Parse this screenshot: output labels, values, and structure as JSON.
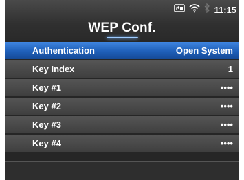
{
  "header": {
    "title": "WEP Conf.",
    "time": "11:15"
  },
  "status_icons": [
    "sd-card-icon",
    "wifi-icon",
    "bluetooth-icon"
  ],
  "menu": {
    "items": [
      {
        "label": "Authentication",
        "value": "Open System",
        "selected": true
      },
      {
        "label": "Key Index",
        "value": "1",
        "selected": false
      },
      {
        "label": "Key #1",
        "value": "••••",
        "selected": false
      },
      {
        "label": "Key #2",
        "value": "••••",
        "selected": false
      },
      {
        "label": "Key #3",
        "value": "••••",
        "selected": false
      },
      {
        "label": "Key #4",
        "value": "••••",
        "selected": false
      }
    ]
  },
  "softkeys": {
    "left": "",
    "right": ""
  },
  "colors": {
    "selected": "#2a6fcf",
    "row": "#4a4a4a",
    "background": "#262626",
    "accent": "#9ecbff"
  }
}
